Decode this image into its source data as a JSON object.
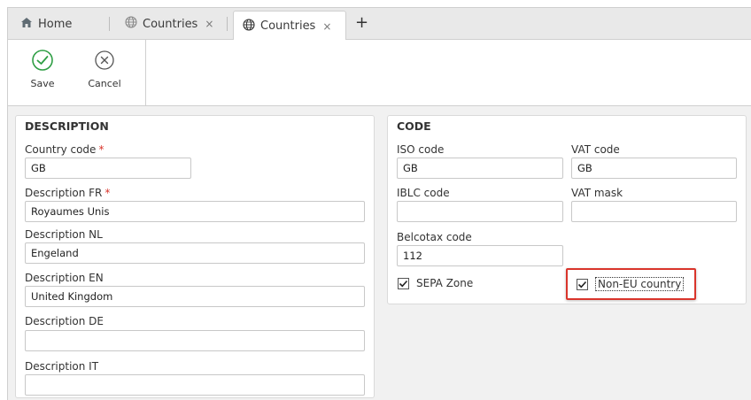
{
  "tabs": {
    "home_label": "Home",
    "tab1_label": "Countries",
    "tab2_label": "Countries",
    "close_glyph": "×",
    "new_tab_glyph": "+"
  },
  "toolbar": {
    "save_label": "Save",
    "cancel_label": "Cancel"
  },
  "description": {
    "title": "DESCRIPTION",
    "country_code": {
      "label": "Country code",
      "value": "GB",
      "required_mark": "*"
    },
    "description_fr": {
      "label": "Description FR",
      "value": "Royaumes Unis",
      "required_mark": "*"
    },
    "description_nl": {
      "label": "Description NL",
      "value": "Engeland"
    },
    "description_en": {
      "label": "Description EN",
      "value": "United Kingdom"
    },
    "description_de": {
      "label": "Description DE",
      "value": ""
    },
    "description_it": {
      "label": "Description IT",
      "value": ""
    }
  },
  "code": {
    "title": "CODE",
    "iso_code": {
      "label": "ISO code",
      "value": "GB"
    },
    "vat_code": {
      "label": "VAT code",
      "value": "GB"
    },
    "iblc_code": {
      "label": "IBLC code",
      "value": ""
    },
    "vat_mask": {
      "label": "VAT mask",
      "value": ""
    },
    "belcotax_code": {
      "label": "Belcotax code",
      "value": "112"
    },
    "sepa_zone": {
      "label": "SEPA Zone",
      "checked": true
    },
    "non_eu_country": {
      "label": "Non-EU country",
      "checked": true
    }
  },
  "colors": {
    "accent_green": "#2e9e44",
    "highlight_red": "#d9342b"
  }
}
